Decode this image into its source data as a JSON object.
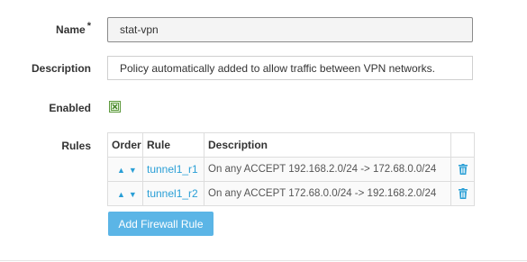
{
  "form": {
    "name_label": "Name",
    "required_mark": "*",
    "name_value": "stat-vpn",
    "description_label": "Description",
    "description_value": "Policy automatically added to allow traffic between VPN networks.",
    "enabled_label": "Enabled",
    "enabled_checked": true,
    "rules_label": "Rules"
  },
  "rules_table": {
    "headers": [
      "Order",
      "Rule",
      "Description",
      ""
    ],
    "rows": [
      {
        "rule": "tunnel1_r1",
        "description": "On any ACCEPT 192.168.2.0/24 -> 172.68.0.0/24"
      },
      {
        "rule": "tunnel1_r2",
        "description": "On any ACCEPT 172.68.0.0/24 -> 192.168.2.0/24"
      }
    ]
  },
  "buttons": {
    "add_rule": "Add Firewall Rule"
  },
  "icons": {
    "move_up": "arrow-up-icon",
    "move_down": "arrow-down-icon",
    "delete": "trash-icon",
    "enabled": "checkbox-checked-icon"
  },
  "colors": {
    "accent": "#2a9fd6",
    "button_bg": "#5bb5e6",
    "check_green": "#5e9a3e"
  }
}
